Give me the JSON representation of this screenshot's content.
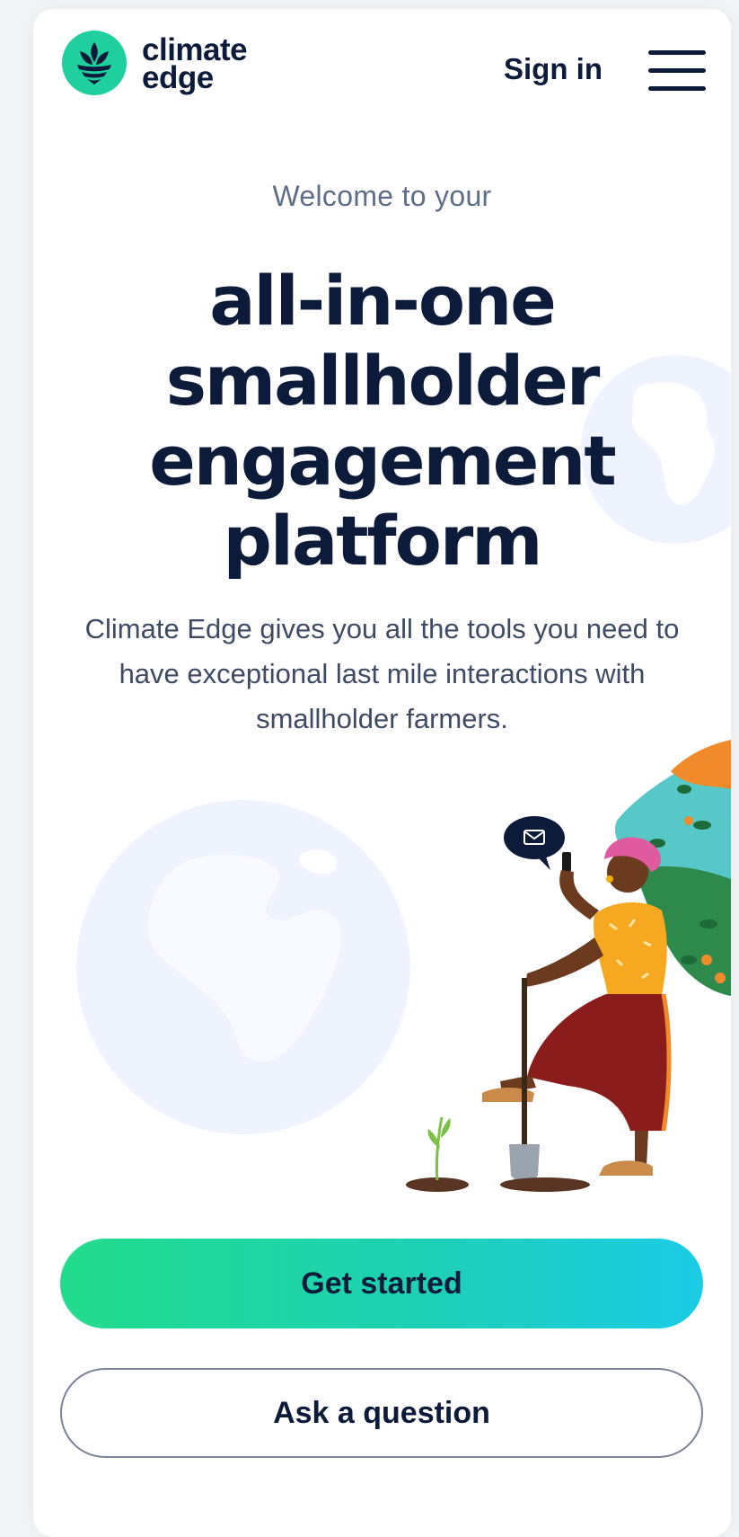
{
  "header": {
    "brand_line1": "climate",
    "brand_line2": "edge",
    "signin_label": "Sign in",
    "menu_icon": "hamburger-menu-icon"
  },
  "hero": {
    "welcome": "Welcome to your",
    "headline_lines": [
      "all-in-one",
      "smallholder",
      "engagement",
      "platform"
    ],
    "description": "Climate Edge gives you all the tools you need to have exceptional last mile interactions with smallholder farmers."
  },
  "actions": {
    "primary_label": "Get started",
    "secondary_label": "Ask a question"
  },
  "colors": {
    "navy": "#0c1b3a",
    "teal": "#1fcf9d",
    "gradient_start": "#22dc8c",
    "gradient_end": "#1ccbe6",
    "globe": "#eef3fd"
  }
}
